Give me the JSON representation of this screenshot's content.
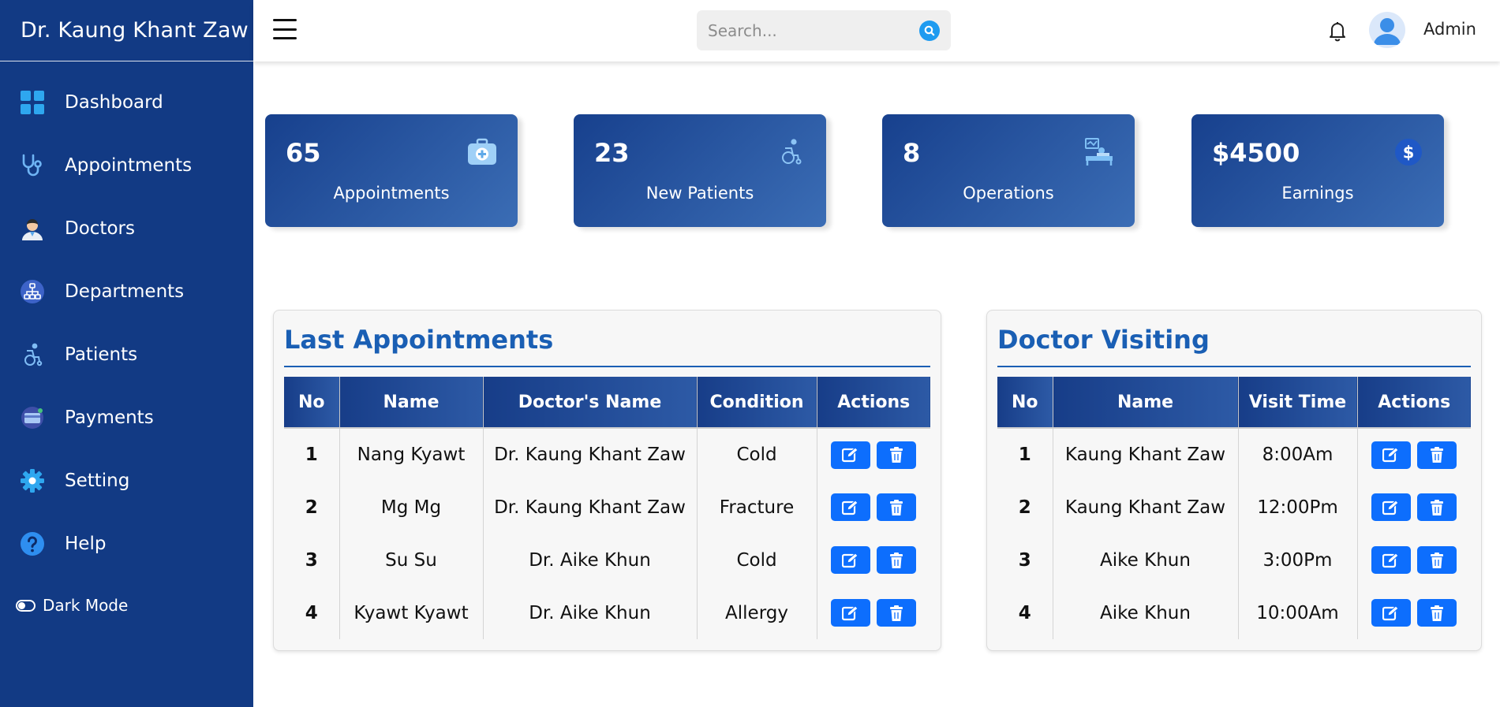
{
  "sidebar": {
    "brand": "Dr. Kaung Khant Zaw",
    "items": [
      {
        "label": "Dashboard",
        "icon": "dashboard-grid-icon"
      },
      {
        "label": "Appointments",
        "icon": "stethoscope-icon"
      },
      {
        "label": "Doctors",
        "icon": "doctor-avatar-icon"
      },
      {
        "label": "Departments",
        "icon": "hierarchy-icon"
      },
      {
        "label": "Patients",
        "icon": "wheelchair-icon"
      },
      {
        "label": "Payments",
        "icon": "card-payment-icon"
      },
      {
        "label": "Setting",
        "icon": "gear-icon"
      },
      {
        "label": "Help",
        "icon": "help-icon"
      }
    ],
    "dark_mode_label": "Dark Mode"
  },
  "header": {
    "search_placeholder": "Search...",
    "user_name": "Admin"
  },
  "stats": [
    {
      "value": "65",
      "label": "Appointments",
      "icon": "first-aid-kit-icon"
    },
    {
      "value": "23",
      "label": "New Patients",
      "icon": "wheelchair-icon"
    },
    {
      "value": "8",
      "label": "Operations",
      "icon": "operation-bed-icon"
    },
    {
      "value": "$4500",
      "label": "Earnings",
      "icon": "dollar-coin-icon"
    }
  ],
  "last_appointments": {
    "title": "Last Appointments",
    "columns": [
      "No",
      "Name",
      "Doctor's Name",
      "Condition",
      "Actions"
    ],
    "rows": [
      {
        "no": "1",
        "name": "Nang Kyawt",
        "doctor": "Dr. Kaung Khant Zaw",
        "condition": "Cold"
      },
      {
        "no": "2",
        "name": "Mg Mg",
        "doctor": "Dr. Kaung Khant Zaw",
        "condition": "Fracture"
      },
      {
        "no": "3",
        "name": "Su Su",
        "doctor": "Dr. Aike Khun",
        "condition": "Cold"
      },
      {
        "no": "4",
        "name": "Kyawt Kyawt",
        "doctor": "Dr. Aike Khun",
        "condition": "Allergy"
      }
    ]
  },
  "doctor_visiting": {
    "title": "Doctor Visiting",
    "columns": [
      "No",
      "Name",
      "Visit Time",
      "Actions"
    ],
    "rows": [
      {
        "no": "1",
        "name": "Kaung Khant Zaw",
        "time": "8:00Am"
      },
      {
        "no": "2",
        "name": "Kaung Khant Zaw",
        "time": "12:00Pm"
      },
      {
        "no": "3",
        "name": "Aike Khun",
        "time": "3:00Pm"
      },
      {
        "no": "4",
        "name": "Aike Khun",
        "time": "10:00Am"
      }
    ]
  },
  "colors": {
    "sidebar": "#123a84",
    "accent": "#1a5fb4",
    "action_button": "#0d6efd",
    "card_gradient_start": "#17408d",
    "card_gradient_end": "#3b6db5"
  }
}
